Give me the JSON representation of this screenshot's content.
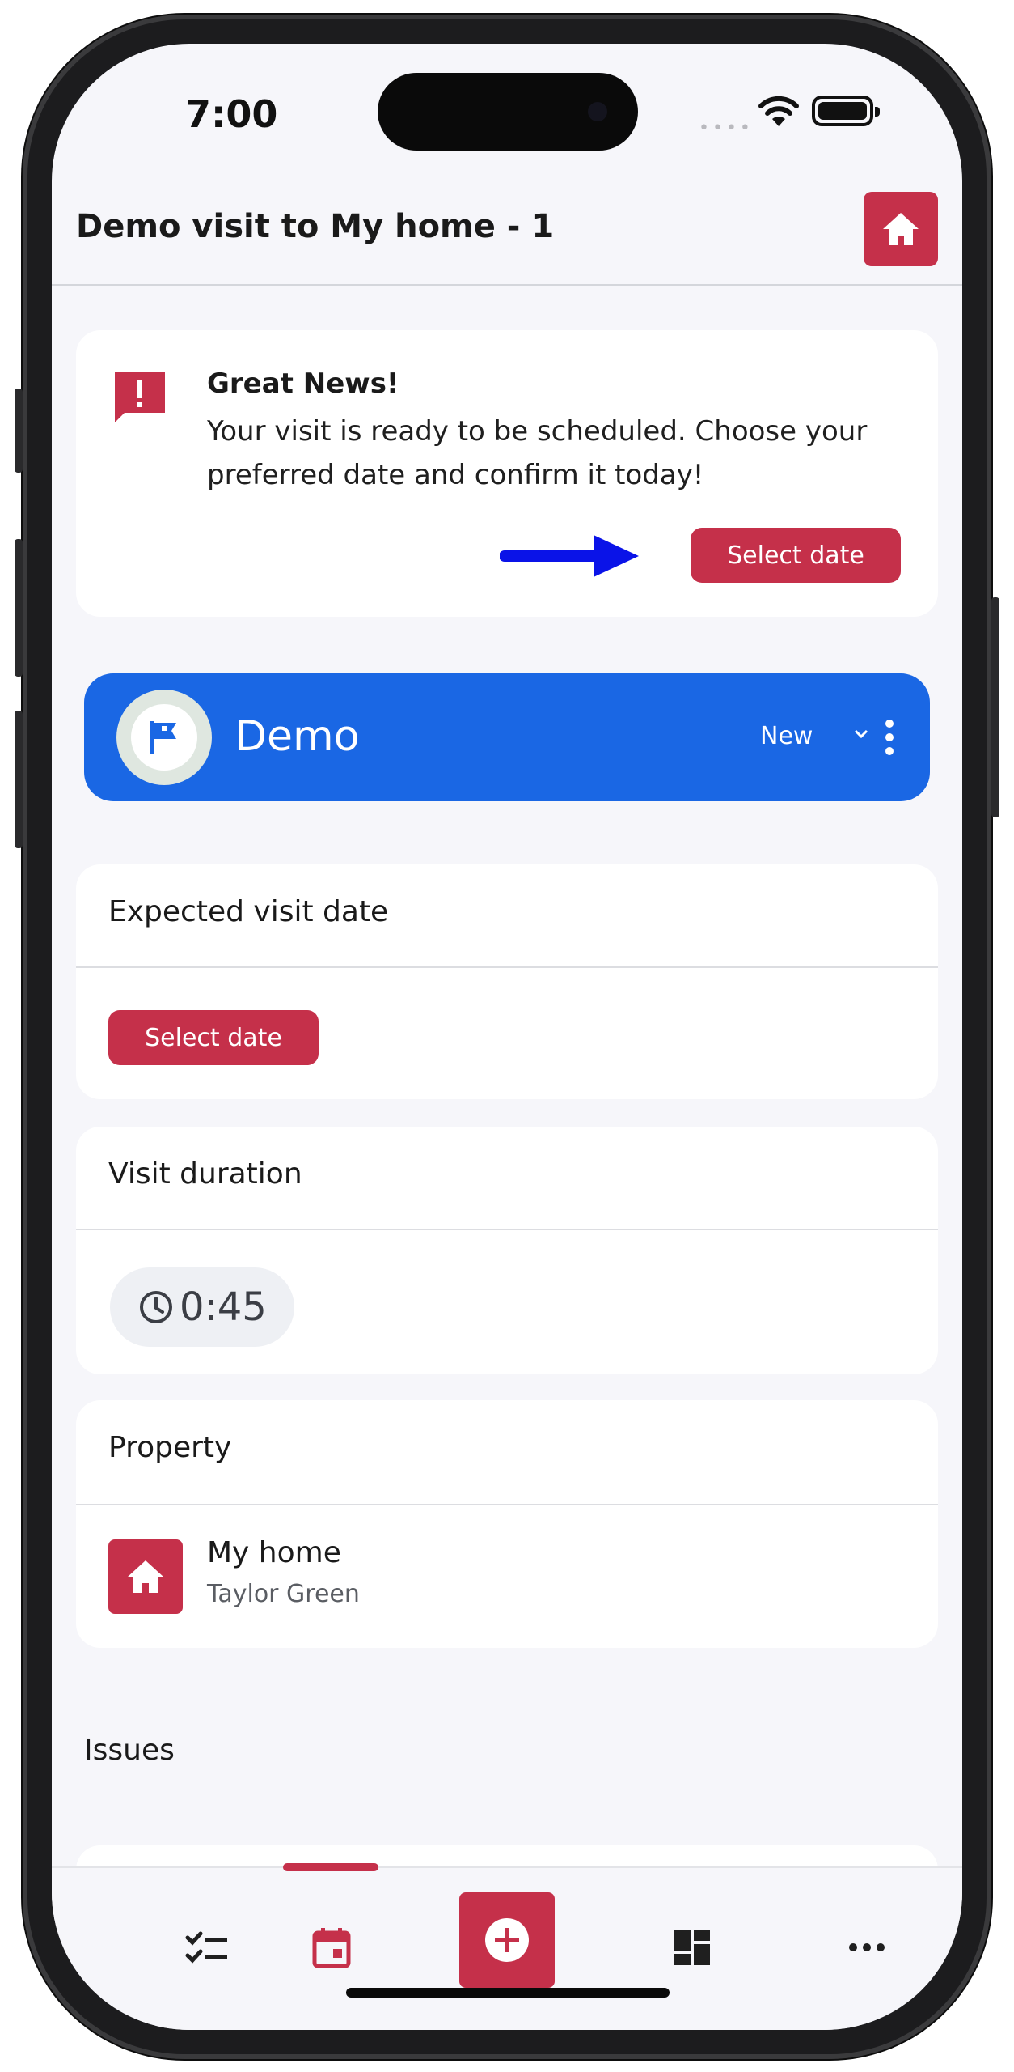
{
  "status_bar": {
    "time": "7:00",
    "signal_dots": "••••"
  },
  "header": {
    "title": "Demo visit to My home - 1",
    "home_icon": "home-icon"
  },
  "notice": {
    "icon": "alert-message-icon",
    "title": "Great News!",
    "body": "Your visit is ready to be scheduled. Choose your preferred date and confirm it today!",
    "button_label": "Select date",
    "arrow_color": "#0a13e8"
  },
  "visit_banner": {
    "name": "Demo",
    "status": "New",
    "avatar_icon": "flag-icon",
    "color": "#1a67e4"
  },
  "expected_date": {
    "heading": "Expected visit date",
    "button_label": "Select date"
  },
  "duration": {
    "heading": "Visit duration",
    "value": "0:45"
  },
  "property": {
    "heading": "Property",
    "name": "My home",
    "owner": "Taylor Green"
  },
  "issues": {
    "heading": "Issues"
  },
  "bottom_nav": {
    "items": [
      {
        "icon": "checklist-icon"
      },
      {
        "icon": "calendar-icon",
        "active": true
      },
      {
        "icon": "add-icon"
      },
      {
        "icon": "dashboard-icon"
      },
      {
        "icon": "more-horizontal-icon"
      }
    ]
  },
  "theme": {
    "accent": "#c5304a",
    "banner": "#1a67e4",
    "background": "#f6f6fa"
  }
}
